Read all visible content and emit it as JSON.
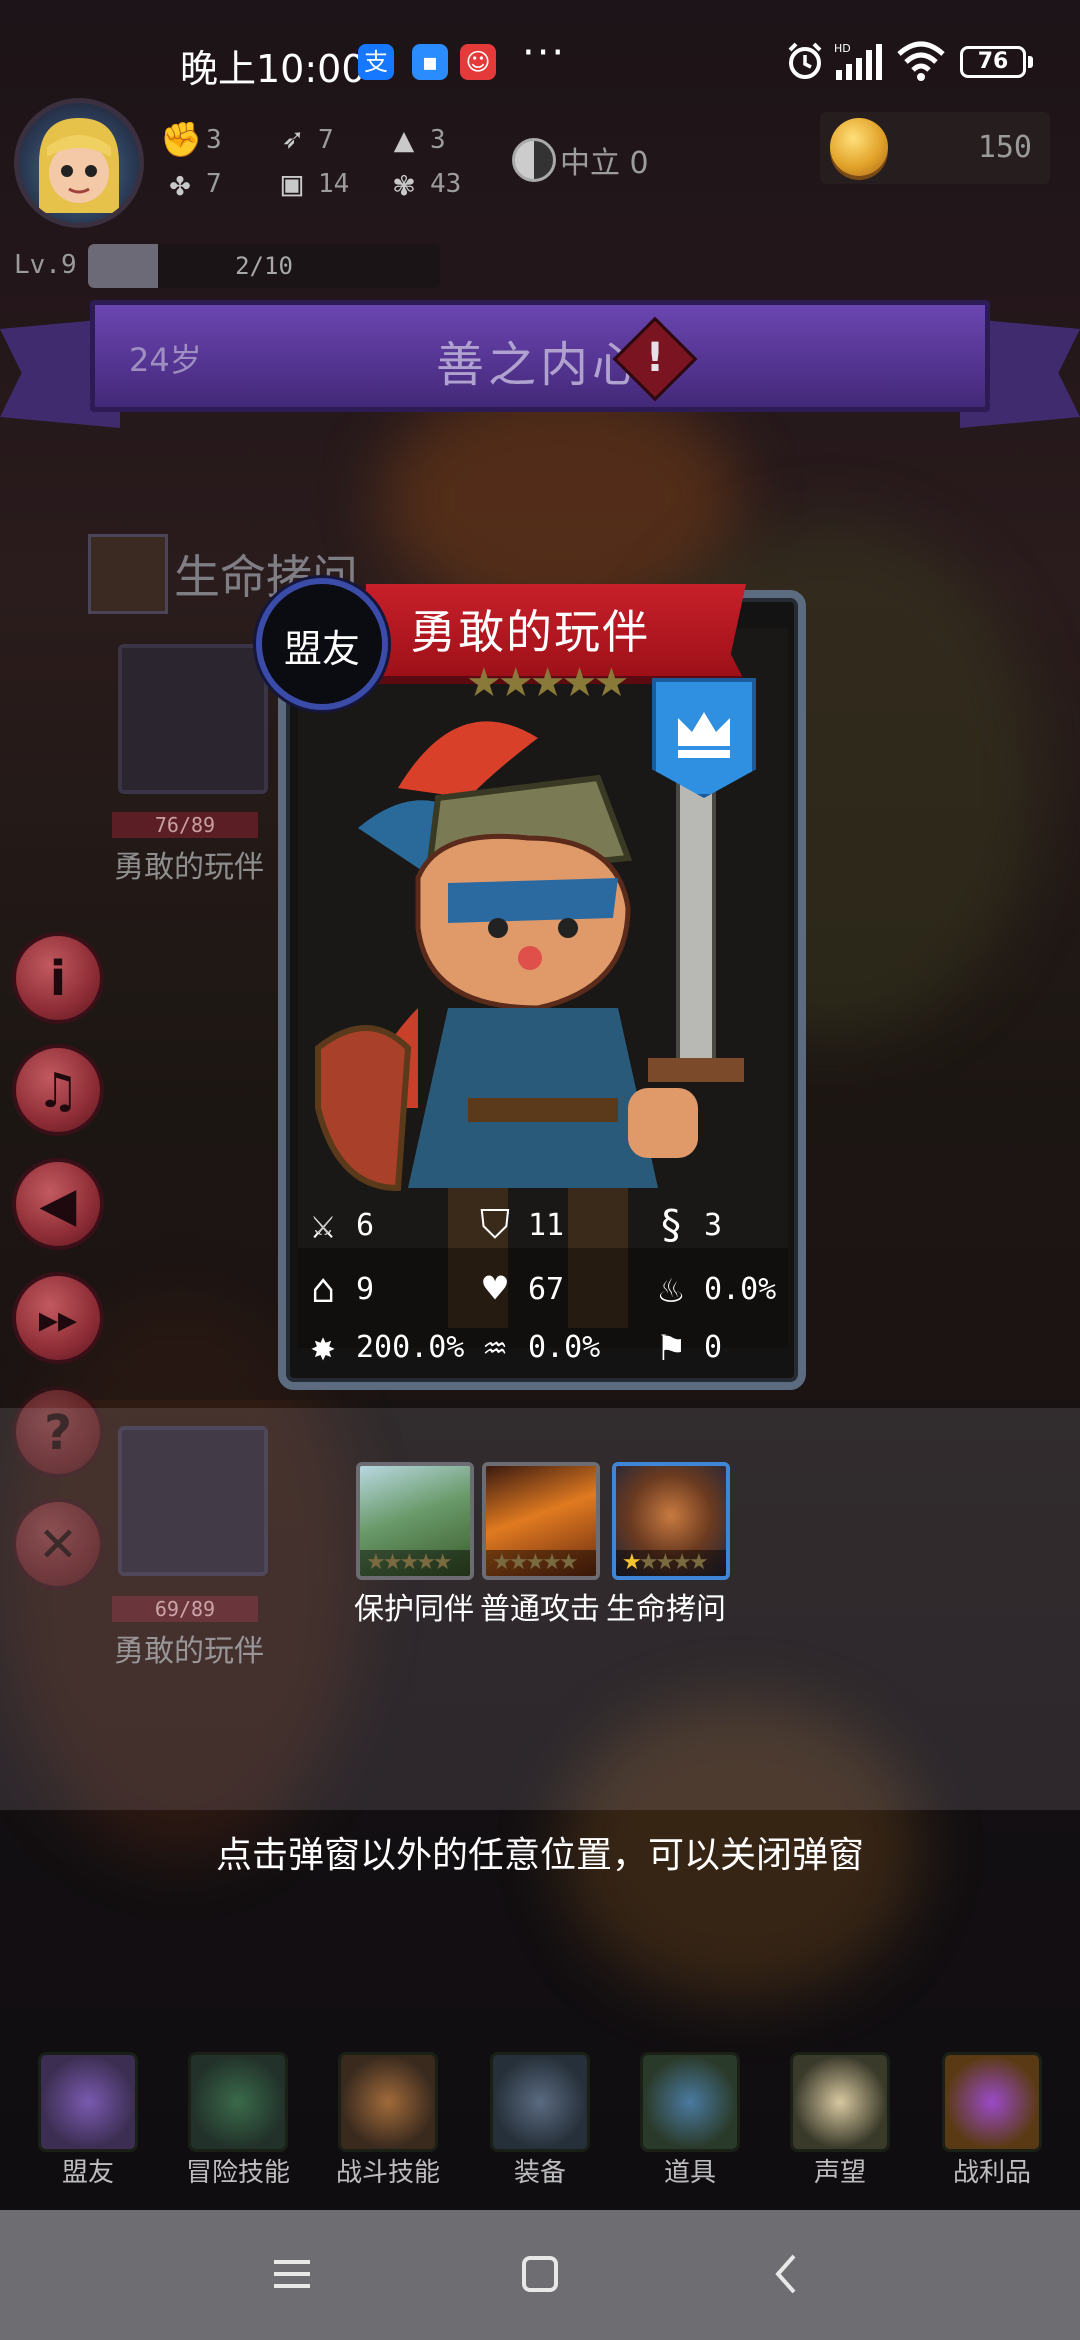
{
  "status_bar": {
    "time": "晚上10:00",
    "battery": "76",
    "more": "···"
  },
  "player": {
    "level_label": "Lv.9",
    "xp_text": "2/10",
    "xp_fraction": 0.2,
    "stats": [
      {
        "icon": "fist-icon",
        "value": "3"
      },
      {
        "icon": "clover-icon",
        "value": "7"
      },
      {
        "icon": "arrow-icon",
        "value": "7"
      },
      {
        "icon": "armor-icon",
        "value": "14"
      },
      {
        "icon": "hat-icon",
        "value": "3"
      },
      {
        "icon": "lotus-icon",
        "value": "43"
      }
    ],
    "alignment": "中立 0",
    "coins": "150"
  },
  "banner": {
    "age": "24岁",
    "title": "善之内心",
    "alert": "!"
  },
  "side_menu": [
    {
      "icon": "info-icon",
      "glyph": "i"
    },
    {
      "icon": "music-icon",
      "glyph": "♫"
    },
    {
      "icon": "sound-icon",
      "glyph": "◀"
    },
    {
      "icon": "fast-forward-icon",
      "glyph": "▸▸"
    },
    {
      "icon": "help-icon",
      "glyph": "?"
    },
    {
      "icon": "close-icon",
      "glyph": "✕"
    }
  ],
  "party_under": [
    {
      "section": "生命拷问",
      "hp": "76/89",
      "name": "勇敢的玩伴"
    },
    {
      "hp": "69/89",
      "name": "勇敢的玩伴"
    }
  ],
  "card": {
    "type_label": "盟友",
    "name": "勇敢的玩伴",
    "stars": "★★★★★",
    "stats": [
      {
        "icon": "sword-icon",
        "value": "6"
      },
      {
        "icon": "shield-icon",
        "value": "11"
      },
      {
        "icon": "whip-icon",
        "value": "3"
      },
      {
        "icon": "hood-icon",
        "value": "9"
      },
      {
        "icon": "heart-icon",
        "value": "67"
      },
      {
        "icon": "flame-icon",
        "value": "0.0%"
      },
      {
        "icon": "burst-icon",
        "value": "200.0%"
      },
      {
        "icon": "tornado-icon",
        "value": "0.0%"
      },
      {
        "icon": "boot-icon",
        "value": "0"
      }
    ]
  },
  "skills": [
    {
      "name": "保护同伴",
      "stars": "★★★★★",
      "filled": 0
    },
    {
      "name": "普通攻击",
      "stars": "★★★★★",
      "filled": 0
    },
    {
      "name": "生命拷问",
      "stars": "★★★★★",
      "filled": 1
    }
  ],
  "hint": "点击弹窗以外的任意位置，可以关闭弹窗",
  "bottom_nav": [
    {
      "label": "盟友",
      "icon": "gloves-icon"
    },
    {
      "label": "冒险技能",
      "icon": "book-icon"
    },
    {
      "label": "战斗技能",
      "icon": "backpack-icon"
    },
    {
      "label": "装备",
      "icon": "crossed-swords-icon"
    },
    {
      "label": "道具",
      "icon": "amulet-icon"
    },
    {
      "label": "声望",
      "icon": "scroll-icon"
    },
    {
      "label": "战利品",
      "icon": "chest-icon"
    }
  ],
  "colors": {
    "banner": "#553593",
    "card_ribbon": "#c8202a",
    "coin": "#e2a32a",
    "side_button": "#8e2d36"
  }
}
